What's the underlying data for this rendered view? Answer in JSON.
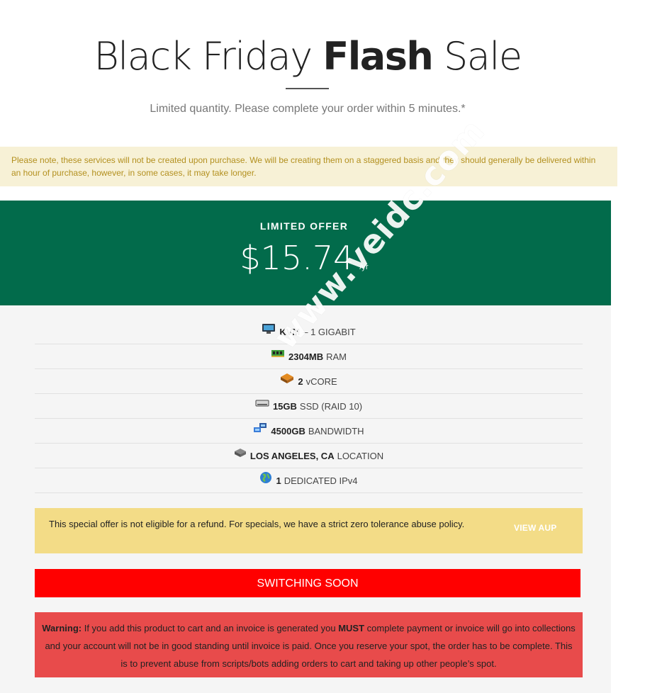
{
  "hero": {
    "title_light": "Black Friday",
    "title_bold": "Flash",
    "title_end": "Sale",
    "subtitle": "Limited quantity. Please complete your order within 5 minutes.*"
  },
  "notice": {
    "text": "Please note, these services will not be created upon purchase. We will be creating them on a staggered basis and they should generally be delivered within an hour of purchase, however, in some cases, it may take longer."
  },
  "offer": {
    "label": "LIMITED OFFER",
    "price": "$15.74",
    "period": "/yr"
  },
  "features": [
    {
      "icon": "monitor-icon",
      "highlight": "KVM",
      "text": "– 1 GIGABIT"
    },
    {
      "icon": "ram-chip-icon",
      "highlight": "2304MB",
      "text": "RAM"
    },
    {
      "icon": "cpu-chip-icon",
      "highlight": "2",
      "text": "vCORE"
    },
    {
      "icon": "drive-icon",
      "highlight": "15GB",
      "text": "SSD (RAID 10)"
    },
    {
      "icon": "network-icon",
      "highlight": "4500GB",
      "text": "BANDWIDTH"
    },
    {
      "icon": "server-icon",
      "highlight": "LOS ANGELES, CA",
      "text": "LOCATION"
    },
    {
      "icon": "globe-icon",
      "highlight": "1",
      "text": "DEDICATED IPv4"
    }
  ],
  "aup": {
    "text": "This special offer is not eligible for a refund. For specials, we have a strict zero tolerance abuse policy.",
    "link_label": "VIEW AUP"
  },
  "cta": {
    "label": "SWITCHING SOON"
  },
  "warning": {
    "label": "Warning:",
    "part1": "If you add this product to cart and an invoice is generated you",
    "must": "MUST",
    "part2": "complete payment or invoice will go into collections and your account will not be in good standing until invoice is paid. Once you reserve your spot, the order has to be complete. This is to prevent abuse from scripts/bots adding orders to cart and taking up other people’s spot."
  },
  "watermark": {
    "text": "www.veidc.com"
  },
  "colors": {
    "header_green": "#026b4b",
    "notice_bg": "#f7f1d6",
    "notice_text": "#b3901f",
    "aup_bg": "#f3dc87",
    "cta_red": "#ff0000",
    "warning_bg": "#e84b4b"
  }
}
